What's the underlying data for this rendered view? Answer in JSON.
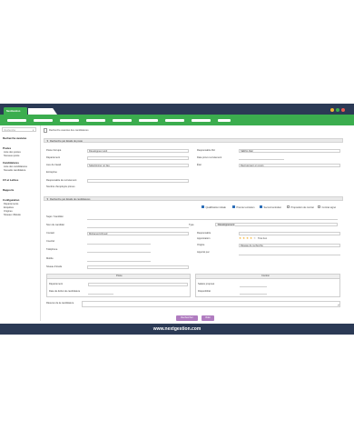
{
  "app": {
    "logo_label": "NextGestion",
    "tab_titles": [
      "",
      "",
      "",
      "",
      "",
      "",
      "",
      "",
      ""
    ]
  },
  "colors": {
    "navy": "#2b3a55",
    "green": "#3bad4e",
    "window_dots": [
      "#f2b233",
      "#3bad4e",
      "#e65a4f"
    ]
  },
  "sidebar": {
    "search_placeholder": "Recherche",
    "sections": [
      {
        "title": "Recherche avancée",
        "items": []
      },
      {
        "title": "Postes",
        "items": [
          "Liste des postes",
          "Nouveau poste"
        ]
      },
      {
        "title": "Candidatures",
        "items": [
          "Liste des candidatures",
          "Nouvelle candidature"
        ]
      },
      {
        "title": "CV et Lettres",
        "items": []
      },
      {
        "title": "Rapports",
        "items": []
      },
      {
        "title": "Configuration",
        "items": [
          "Départements",
          "Enquêtes",
          "Origines",
          "Niveaux d'Etude"
        ]
      }
    ]
  },
  "page": {
    "title": "Recherche avancée des candidatures"
  },
  "poste_section": {
    "header": "Recherche par détails du poste",
    "left": [
      {
        "label": "Poste Occupé",
        "value": "Développeur web"
      },
      {
        "label": "Département",
        "value": ""
      },
      {
        "label": "Lieu de travail",
        "value": "Sélectionner un lieu"
      },
      {
        "label": "Entreprise",
        "value": ""
      },
      {
        "label": "Responsable de recrutement",
        "value": ""
      },
      {
        "label": "Nombre d'employés prévus",
        "value": ""
      }
    ],
    "right": [
      {
        "label": "Responsable RH",
        "value": "SERGI Allal"
      },
      {
        "label": "Date prévu recrutement",
        "value": ""
      },
      {
        "label": "État",
        "value": "Recrutement en cours"
      }
    ]
  },
  "cand_section": {
    "header": "Recherche par détails de candidatures",
    "checkboxes": [
      {
        "label": "Qualification initiale",
        "checked": true
      },
      {
        "label": "Premier entretien",
        "checked": true
      },
      {
        "label": "Second entretien",
        "checked": true
      },
      {
        "label": "Proposition de contrat",
        "checked": false
      },
      {
        "label": "Contrat signé",
        "checked": false
      }
    ],
    "sujet_label": "Sujet / Candidat",
    "nom_label": "Nom du candidat",
    "type_label": "Type",
    "type_value": "Développement",
    "left": [
      {
        "label": "Contact",
        "value": "Mohamed Ahmed"
      },
      {
        "label": "Courriel",
        "value": ""
      },
      {
        "label": "Téléphone",
        "value": ""
      },
      {
        "label": "Mobile",
        "value": ""
      },
      {
        "label": "Niveau d'étude",
        "value": ""
      }
    ],
    "right": [
      {
        "label": "Responsable",
        "value": ""
      },
      {
        "label": "Appréciation",
        "value": "Très bon"
      },
      {
        "label": "Origine",
        "value": "Réseau de recherche"
      },
      {
        "label": "Apporté par",
        "value": ""
      }
    ],
    "rating": 4,
    "rating_max": 5,
    "poste_box": {
      "title": "Poste",
      "rows": [
        "Département",
        "Date de début de candidature"
      ]
    },
    "contrat_box": {
      "title": "Contrat",
      "rows": [
        "Salaire proposé",
        "Disponibilité"
      ]
    },
    "resume_label": "Résumé de la candidature"
  },
  "buttons": {
    "search": "Rechercher",
    "clear": "Vider"
  },
  "footer": {
    "url": "www.nextgestion.com"
  }
}
